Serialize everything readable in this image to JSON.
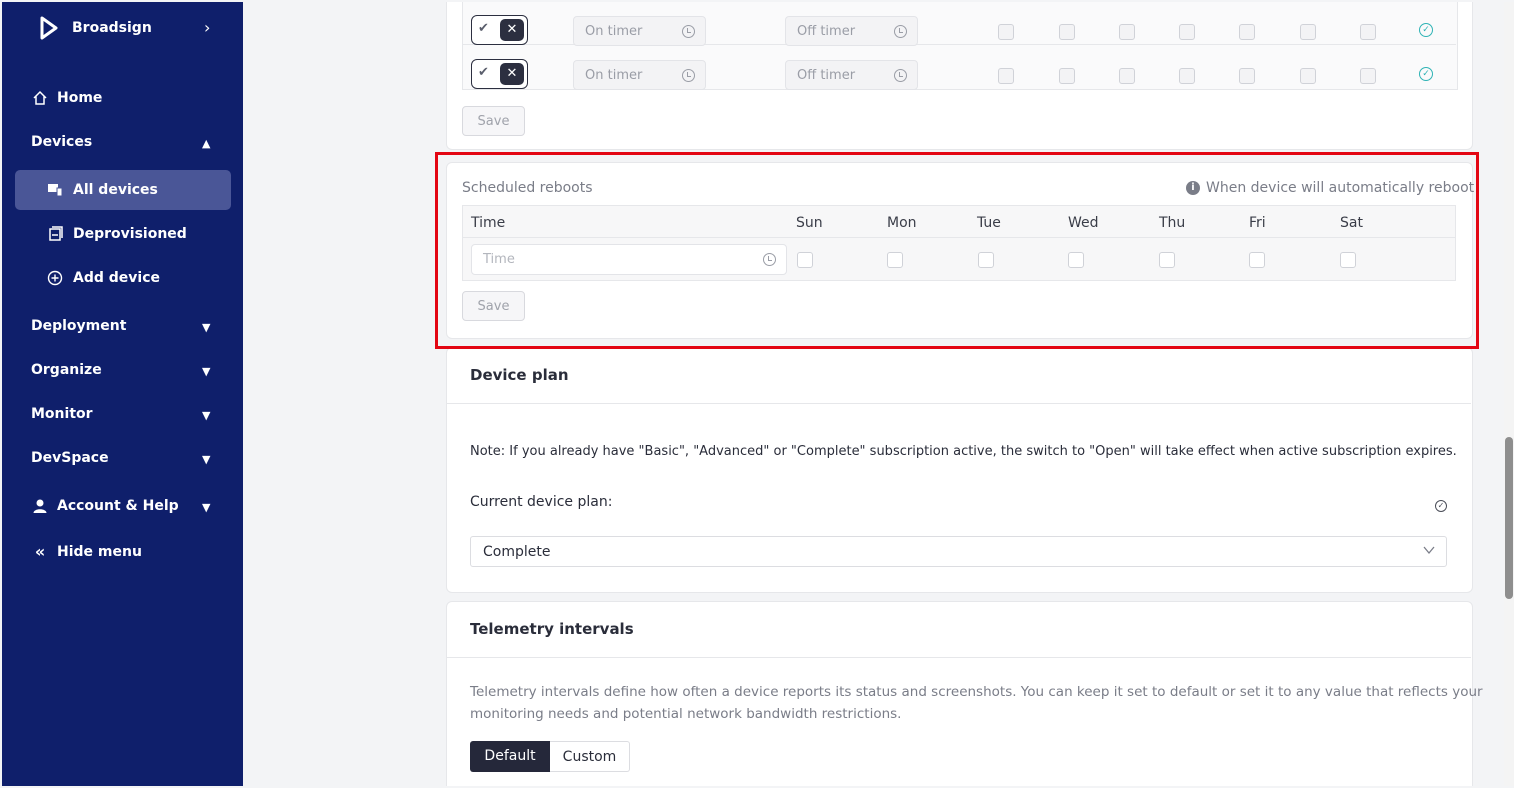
{
  "sidebar": {
    "brand": "Broadsign",
    "items": [
      {
        "label": "Home"
      },
      {
        "label": "Devices"
      },
      {
        "label": "All devices"
      },
      {
        "label": "Deprovisioned"
      },
      {
        "label": "Add device"
      },
      {
        "label": "Deployment"
      },
      {
        "label": "Organize"
      },
      {
        "label": "Monitor"
      },
      {
        "label": "DevSpace"
      },
      {
        "label": "Account & Help"
      },
      {
        "label": "Hide menu"
      }
    ]
  },
  "timers": {
    "on_placeholder": "On timer",
    "off_placeholder": "Off timer",
    "save": "Save"
  },
  "reboots": {
    "title": "Scheduled reboots",
    "info": "When device will automatically reboot",
    "col_time": "Time",
    "days": [
      "Sun",
      "Mon",
      "Tue",
      "Wed",
      "Thu",
      "Fri",
      "Sat"
    ],
    "time_placeholder": "Time",
    "save": "Save"
  },
  "plan": {
    "title": "Device plan",
    "note": "Note: If you already have \"Basic\", \"Advanced\" or \"Complete\" subscription active, the switch to \"Open\" will take effect when active subscription expires.",
    "current_label": "Current device plan:",
    "selected": "Complete"
  },
  "telemetry": {
    "title": "Telemetry intervals",
    "desc1": "Telemetry intervals define how often a device reports its status and screenshots. You can keep it set to default or set it to any value that reflects your",
    "desc2": "monitoring needs and potential network bandwidth restrictions.",
    "default_label": "Default",
    "custom_label": "Custom"
  },
  "colors": {
    "sidebar_bg": "#0f1f6b",
    "active_item": "#4a5697",
    "highlight": "#e30613",
    "accent": "#2fb3b5"
  }
}
